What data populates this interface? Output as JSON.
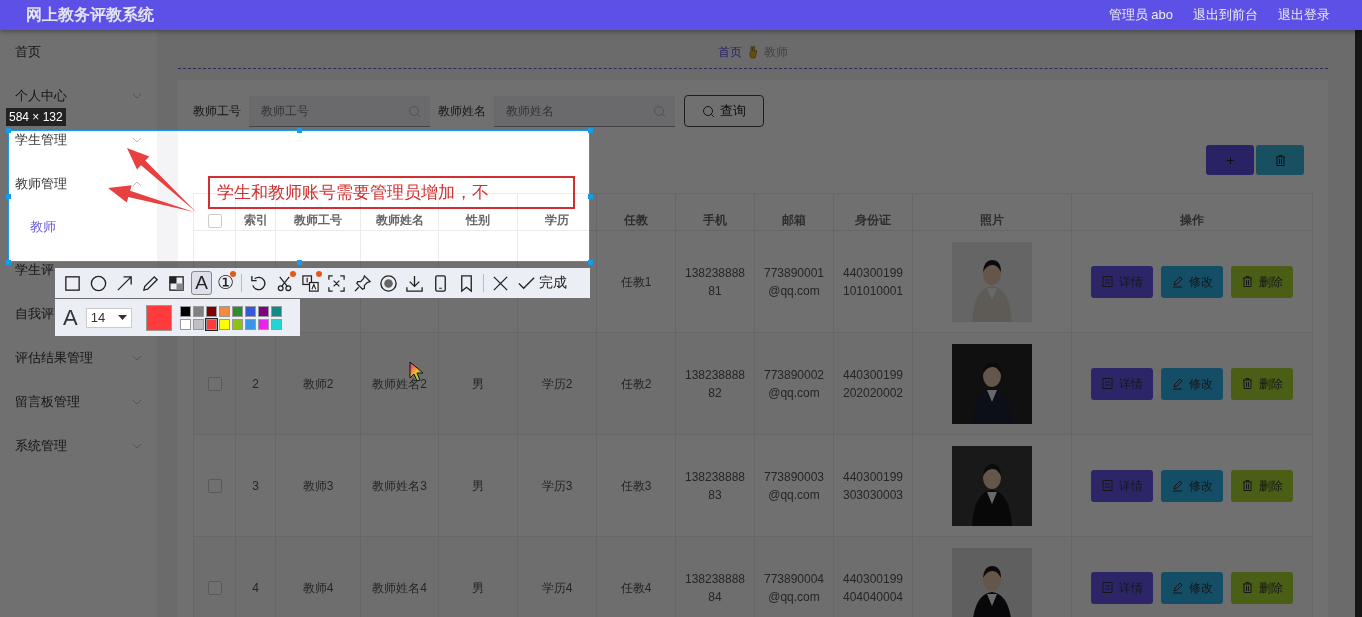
{
  "header": {
    "title": "网上教务评教系统",
    "user": "管理员 abo",
    "links": [
      "退出到前台",
      "退出登录"
    ]
  },
  "sidebar": {
    "items": [
      {
        "label": "首页"
      },
      {
        "label": "个人中心",
        "expanded": false
      },
      {
        "label": "学生管理",
        "expanded": false
      },
      {
        "label": "教师管理",
        "expanded": true,
        "children": [
          {
            "label": "教师",
            "selected": true
          }
        ]
      },
      {
        "label": "学生评"
      },
      {
        "label": "自我评"
      },
      {
        "label": "评估结果管理",
        "expanded": false
      },
      {
        "label": "留言板管理",
        "expanded": false
      },
      {
        "label": "系统管理",
        "expanded": false
      }
    ]
  },
  "breadcrumb": [
    "首页",
    "教师"
  ],
  "search": {
    "fields": [
      {
        "label": "教师工号",
        "placeholder": "教师工号"
      },
      {
        "label": "教师姓名",
        "placeholder": "教师姓名"
      }
    ],
    "button": "查询"
  },
  "table": {
    "all_checked": false,
    "columns": [
      "",
      "索引",
      "教师工号",
      "教师姓名",
      "性别",
      "学历",
      "任教",
      "手机",
      "邮箱",
      "身份证",
      "照片",
      "操作"
    ],
    "rows": [
      {
        "cells": {
          "subject": "任教1",
          "phone": "13823888881",
          "email": "773890001@qq.com",
          "id_card": "440300199101010001"
        },
        "photo": {
          "kind": "picture"
        },
        "actions": [
          "详情",
          "修改",
          "删除"
        ]
      },
      {
        "checked": false,
        "cells": {
          "index": "2",
          "number": "教师2",
          "name": "教师姓名2",
          "gender": "男",
          "education": "学历2",
          "subject": "任教2",
          "phone": "13823888882",
          "email": "773890002@qq.com",
          "id_card": "440300199202020002"
        },
        "photo": {
          "kind": "picture"
        },
        "actions": [
          "详情",
          "修改",
          "删除"
        ]
      },
      {
        "checked": false,
        "cells": {
          "index": "3",
          "number": "教师3",
          "name": "教师姓名3",
          "gender": "男",
          "education": "学历3",
          "subject": "任教3",
          "phone": "13823888883",
          "email": "773890003@qq.com",
          "id_card": "440300199303030003"
        },
        "photo": {
          "kind": "picture"
        },
        "actions": [
          "详情",
          "修改",
          "删除"
        ]
      },
      {
        "checked": false,
        "cells": {
          "index": "4",
          "number": "教师4",
          "name": "教师姓名4",
          "gender": "男",
          "education": "学历4",
          "subject": "任教4",
          "phone": "13823888884",
          "email": "773890004@qq.com",
          "id_card": "440300199404040004"
        },
        "photo": {
          "kind": "picture"
        },
        "actions": [
          "详情",
          "修改",
          "删除"
        ]
      }
    ]
  },
  "capture": {
    "size": "584 × 132",
    "annotation": "学生和教师账号需要管理员增加，不",
    "tool_groups": [
      [
        {
          "kind": "rectangle",
          "selected": false,
          "badge": false
        },
        {
          "kind": "ellipse",
          "selected": false,
          "badge": false
        },
        {
          "kind": "arrow",
          "selected": false,
          "badge": false
        },
        {
          "kind": "pencil",
          "selected": false,
          "badge": false
        },
        {
          "kind": "mosaic",
          "selected": false,
          "badge": false
        },
        {
          "kind": "text",
          "glyph": "A",
          "selected": true,
          "badge": false
        },
        {
          "kind": "number",
          "glyph": "①",
          "selected": false,
          "badge": true
        }
      ],
      [
        {
          "kind": "undo",
          "selected": false,
          "badge": false
        },
        {
          "kind": "scissors",
          "selected": false,
          "badge": true
        },
        {
          "kind": "translate",
          "selected": false,
          "badge": true
        },
        {
          "kind": "scan",
          "selected": false,
          "badge": false
        },
        {
          "kind": "pin",
          "selected": false,
          "badge": false
        },
        {
          "kind": "record",
          "selected": false,
          "badge": false
        },
        {
          "kind": "download",
          "selected": false,
          "badge": false
        },
        {
          "kind": "phone",
          "selected": false,
          "badge": false
        },
        {
          "kind": "bookmark",
          "selected": false,
          "badge": false
        }
      ],
      [
        {
          "kind": "close",
          "selected": false,
          "badge": false
        },
        {
          "kind": "done",
          "label": "完成",
          "selected": false,
          "badge": false
        }
      ]
    ],
    "font_glyph": "A",
    "font_size": "14",
    "palette": [
      {
        "color": "#000000",
        "selected": false
      },
      {
        "color": "#808080",
        "selected": false
      },
      {
        "color": "#800000",
        "selected": false
      },
      {
        "color": "#f58a3c",
        "selected": false
      },
      {
        "color": "#2e8b2e",
        "selected": false
      },
      {
        "color": "#3558d8",
        "selected": false
      },
      {
        "color": "#800080",
        "selected": false
      },
      {
        "color": "#128a8a",
        "selected": false
      },
      {
        "color": "#ffffff",
        "selected": false
      },
      {
        "color": "#c0c0c0",
        "selected": false
      },
      {
        "color": "#ff3b3b",
        "selected": true
      },
      {
        "color": "#ffff00",
        "selected": false
      },
      {
        "color": "#8cc21a",
        "selected": false
      },
      {
        "color": "#3a95e8",
        "selected": false
      },
      {
        "color": "#ee22ee",
        "selected": false
      },
      {
        "color": "#22d4d4",
        "selected": false
      }
    ]
  }
}
